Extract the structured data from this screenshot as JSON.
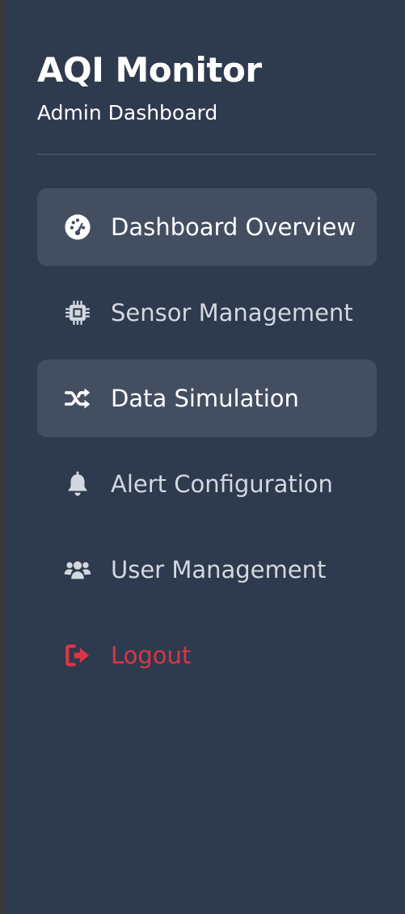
{
  "brand": {
    "title": "AQI Monitor",
    "subtitle": "Admin Dashboard"
  },
  "colors": {
    "sidebar_bg": "#2e3a4e",
    "highlight_bg": "#434f61",
    "danger": "#dc3545",
    "text": "#d3d8e0"
  },
  "nav": {
    "items": [
      {
        "label": "Dashboard Overview",
        "icon": "gauge-icon",
        "highlighted": true
      },
      {
        "label": "Sensor Management",
        "icon": "microchip-icon",
        "highlighted": false
      },
      {
        "label": "Data Simulation",
        "icon": "shuffle-icon",
        "highlighted": true
      },
      {
        "label": "Alert Configuration",
        "icon": "bell-icon",
        "highlighted": false
      },
      {
        "label": "User Management",
        "icon": "users-icon",
        "highlighted": false
      },
      {
        "label": "Logout",
        "icon": "logout-icon",
        "highlighted": false
      }
    ]
  }
}
